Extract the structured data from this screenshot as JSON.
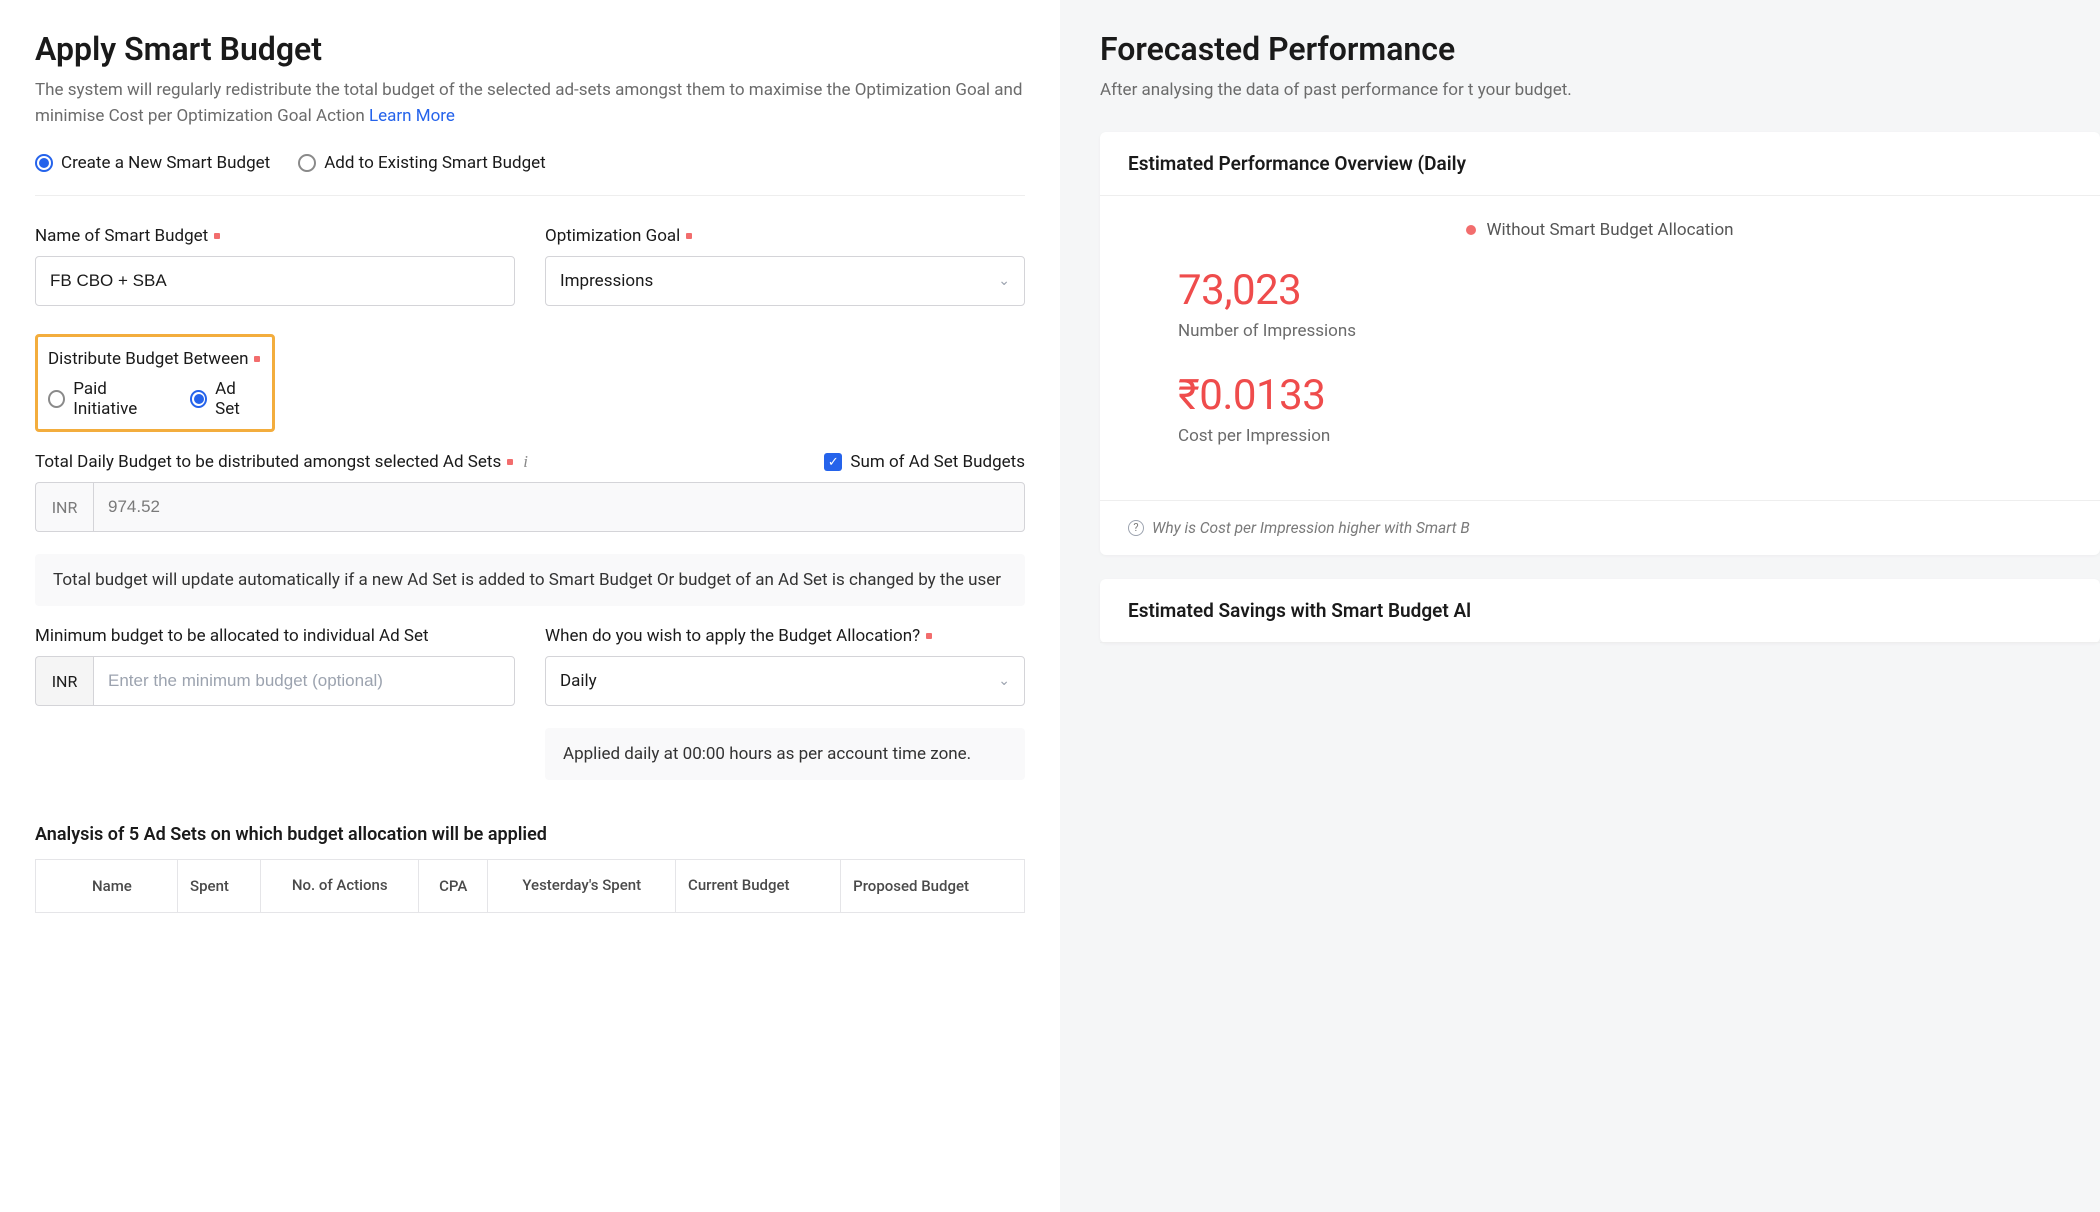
{
  "header": {
    "title": "Apply Smart Budget",
    "subtitle": "The system will regularly redistribute the total budget of the selected ad-sets amongst them to maximise the Optimization Goal and minimise Cost per Optimization Goal Action",
    "learn_more": "Learn More"
  },
  "mode_radio": {
    "create": "Create a New Smart Budget",
    "add": "Add to Existing Smart Budget",
    "selected": "create"
  },
  "name_field": {
    "label": "Name of Smart Budget",
    "value": "FB CBO + SBA"
  },
  "goal_field": {
    "label": "Optimization Goal",
    "value": "Impressions"
  },
  "distribute": {
    "label": "Distribute Budget Between",
    "paid": "Paid Initiative",
    "adset": "Ad Set",
    "selected": "adset"
  },
  "total_budget": {
    "label": "Total Daily Budget to be distributed amongst selected Ad Sets",
    "currency": "INR",
    "value": "974.52",
    "sum_checkbox": "Sum of Ad Set Budgets",
    "note": "Total budget will update automatically if a new Ad Set is added to Smart Budget Or budget of an Ad Set is changed by the user"
  },
  "min_budget": {
    "label": "Minimum budget to be allocated to individual Ad Set",
    "currency": "INR",
    "placeholder": "Enter the minimum budget (optional)"
  },
  "schedule": {
    "label": "When do you wish to apply the Budget Allocation?",
    "value": "Daily",
    "note": "Applied daily at 00:00 hours as per account time zone."
  },
  "analysis": {
    "heading": "Analysis of 5 Ad Sets on which budget allocation will be applied",
    "columns": [
      "Name",
      "Spent",
      "No. of Actions",
      "CPA",
      "Yesterday's Spent",
      "Current Budget",
      "Proposed Budget"
    ]
  },
  "forecast": {
    "title": "Forecasted Performance",
    "subtitle": "After analysing the data of past performance for t your budget.",
    "card1_title": "Estimated Performance Overview (Daily",
    "legend": "Without Smart Budget Allocation",
    "metric1_value": "73,023",
    "metric1_label": "Number of Impressions",
    "metric2_value": "₹0.0133",
    "metric2_label": "Cost per Impression",
    "why": "Why is Cost per Impression higher with Smart B",
    "card2_title": "Estimated Savings with Smart Budget Al"
  }
}
